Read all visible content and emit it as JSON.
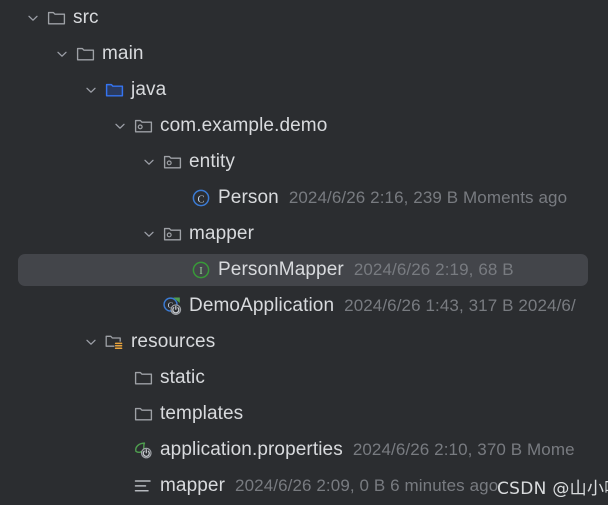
{
  "theme": {
    "background": "#2b2d30",
    "selected_row_background": "#43454a",
    "label_color": "#d8dadd",
    "meta_color": "#787b80",
    "source_folder_blue": "#3574f0",
    "interface_green": "#389a38",
    "class_blue": "#3b7bd4",
    "resources_orange": "#e8a33d"
  },
  "tree": {
    "rows": [
      {
        "id": "src",
        "label": "src",
        "meta": "",
        "depth": 1,
        "chevron": "chevron-down-icon",
        "icon": "folder-icon",
        "selected": false
      },
      {
        "id": "main",
        "label": "main",
        "meta": "",
        "depth": 2,
        "chevron": "chevron-down-icon",
        "icon": "folder-icon",
        "selected": false
      },
      {
        "id": "java",
        "label": "java",
        "meta": "",
        "depth": 3,
        "chevron": "chevron-down-icon",
        "icon": "source-root-folder-icon",
        "selected": false
      },
      {
        "id": "com-example-demo",
        "label": "com.example.demo",
        "meta": "",
        "depth": 4,
        "chevron": "chevron-down-icon",
        "icon": "package-icon",
        "selected": false
      },
      {
        "id": "entity",
        "label": "entity",
        "meta": "",
        "depth": 5,
        "chevron": "chevron-down-icon",
        "icon": "package-icon",
        "selected": false
      },
      {
        "id": "person",
        "label": "Person",
        "meta": "2024/6/26 2:16, 239 B Moments ago",
        "depth": 6,
        "chevron": "none",
        "icon": "java-class-icon",
        "selected": false
      },
      {
        "id": "mapper-package",
        "label": "mapper",
        "meta": "",
        "depth": 5,
        "chevron": "chevron-down-icon",
        "icon": "package-icon",
        "selected": false
      },
      {
        "id": "person-mapper",
        "label": "PersonMapper",
        "meta": "2024/6/26 2:19, 68 B",
        "depth": 6,
        "chevron": "none",
        "icon": "java-interface-icon",
        "selected": true
      },
      {
        "id": "demo-application",
        "label": "DemoApplication",
        "meta": "2024/6/26 1:43, 317 B 2024/6/",
        "depth": 5,
        "chevron": "none",
        "icon": "spring-boot-class-icon",
        "selected": false
      },
      {
        "id": "resources",
        "label": "resources",
        "meta": "",
        "depth": 3,
        "chevron": "chevron-down-icon",
        "icon": "resources-root-folder-icon",
        "selected": false
      },
      {
        "id": "static",
        "label": "static",
        "meta": "",
        "depth": 4,
        "chevron": "none",
        "icon": "folder-icon",
        "selected": false
      },
      {
        "id": "templates",
        "label": "templates",
        "meta": "",
        "depth": 4,
        "chevron": "none",
        "icon": "folder-icon",
        "selected": false
      },
      {
        "id": "application-properties",
        "label": "application.properties",
        "meta": "2024/6/26 2:10, 370 B Mome",
        "depth": 4,
        "chevron": "none",
        "icon": "spring-properties-icon",
        "selected": false
      },
      {
        "id": "mapper-dir",
        "label": "mapper",
        "meta": "2024/6/26 2:09, 0 B 6 minutes ago",
        "depth": 4,
        "chevron": "none",
        "icon": "lines-list-icon",
        "selected": false
      }
    ]
  },
  "watermark": {
    "text": "CSDN @山小嗨"
  }
}
